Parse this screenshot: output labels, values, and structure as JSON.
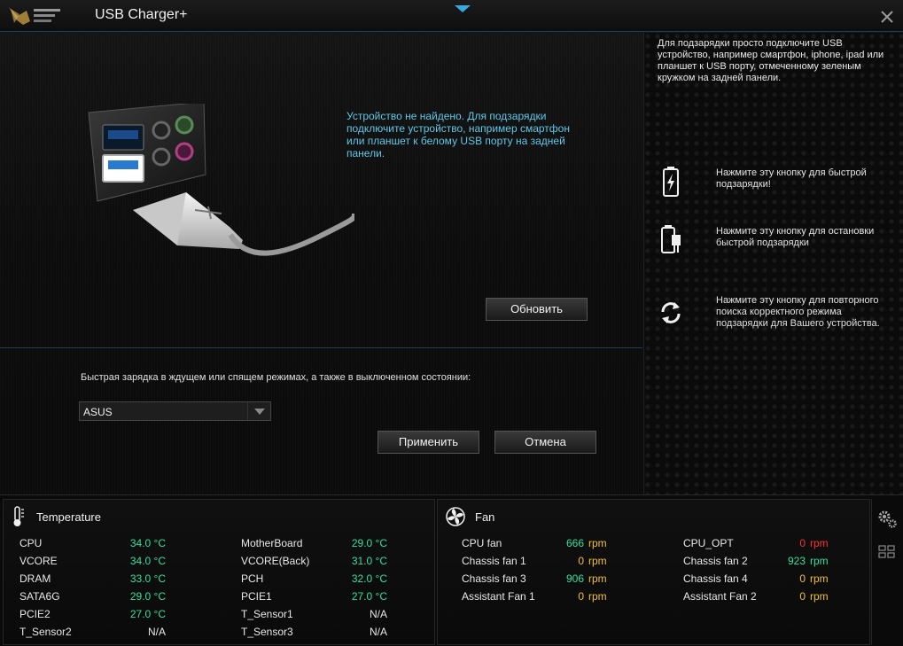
{
  "window": {
    "title": "USB Charger+"
  },
  "main": {
    "status_message": "Устройство не найдено. Для подзарядки подключите устройство, например смартфон или планшет к белому USB порту на задней панели.",
    "refresh_button": "Обновить",
    "charge_mode_label": "Быстрая зарядка в ждущем или спящем режимах, а также в выключенном состоянии:",
    "charge_mode_select": "ASUS",
    "apply_button": "Применить",
    "cancel_button": "Отмена"
  },
  "right_panel": {
    "intro": "Для подзарядки просто подключите USB устройство, например смартфон, iphone, ipad или планшет к USB порту, отмеченному зеленым кружком на задней панели.",
    "items": [
      {
        "icon": "battery-bolt-icon",
        "text": "Нажмите эту кнопку для быстрой подзарядки!"
      },
      {
        "icon": "battery-plug-icon",
        "text": "Нажмите эту кнопку для остановки быстрой подзарядки"
      },
      {
        "icon": "refresh-icon",
        "text": "Нажмите эту кнопку для повторного поиска корректного режима подзарядки для Вашего устройства."
      }
    ]
  },
  "temperature": {
    "title": "Temperature",
    "left": [
      {
        "label": "CPU",
        "value": "34.0 °C"
      },
      {
        "label": "VCORE",
        "value": "34.0 °C"
      },
      {
        "label": "DRAM",
        "value": "33.0 °C"
      },
      {
        "label": "SATA6G",
        "value": "29.0 °C"
      },
      {
        "label": "PCIE2",
        "value": "27.0 °C"
      },
      {
        "label": "T_Sensor2",
        "value": "N/A"
      }
    ],
    "right": [
      {
        "label": "MotherBoard",
        "value": "29.0 °C"
      },
      {
        "label": "VCORE(Back)",
        "value": "31.0 °C"
      },
      {
        "label": "PCH",
        "value": "32.0 °C"
      },
      {
        "label": "PCIE1",
        "value": "27.0 °C"
      },
      {
        "label": "T_Sensor1",
        "value": "N/A"
      },
      {
        "label": "T_Sensor3",
        "value": "N/A"
      }
    ]
  },
  "fan": {
    "title": "Fan",
    "unit": "rpm",
    "left": [
      {
        "label": "CPU fan",
        "value": "666"
      },
      {
        "label": "Chassis fan 1",
        "value": "0"
      },
      {
        "label": "Chassis fan 3",
        "value": "906"
      },
      {
        "label": "Assistant Fan 1",
        "value": "0"
      }
    ],
    "right": [
      {
        "label": "CPU_OPT",
        "value": "0"
      },
      {
        "label": "Chassis fan 2",
        "value": "923"
      },
      {
        "label": "Chassis fan 4",
        "value": "0"
      },
      {
        "label": "Assistant Fan 2",
        "value": "0"
      }
    ]
  },
  "colors": {
    "accent_blue": "#3aa8e0",
    "status_cyan": "#5ec8e8",
    "temp_green": "#33e0a0",
    "fan_yellow": "#f0c030",
    "fan_red": "#ff3030"
  }
}
